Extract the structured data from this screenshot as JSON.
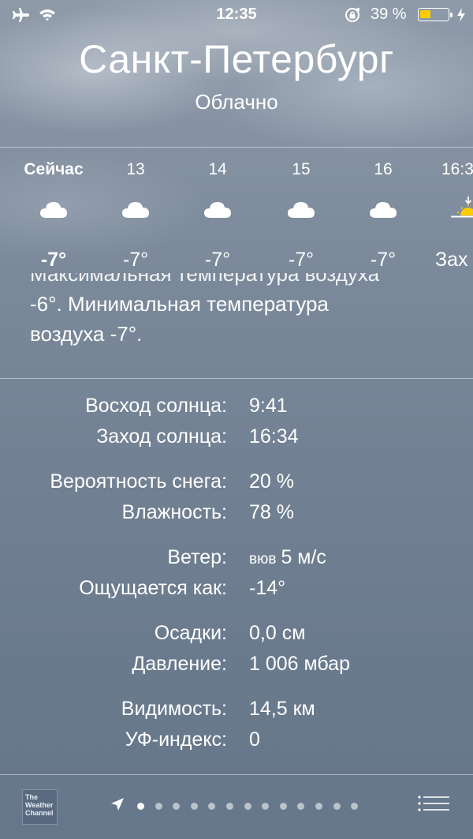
{
  "status_bar": {
    "time": "12:35",
    "battery_percent_text": "39 %",
    "battery_level": 0.39,
    "battery_color": "#ffcc00"
  },
  "header": {
    "city": "Санкт-Петербург",
    "condition": "Облачно"
  },
  "hourly": [
    {
      "label": "Сейчас",
      "icon": "cloud-icon",
      "temp": "-7°"
    },
    {
      "label": "13",
      "icon": "cloud-icon",
      "temp": "-7°"
    },
    {
      "label": "14",
      "icon": "cloud-icon",
      "temp": "-7°"
    },
    {
      "label": "15",
      "icon": "cloud-icon",
      "temp": "-7°"
    },
    {
      "label": "16",
      "icon": "cloud-icon",
      "temp": "-7°"
    },
    {
      "label": "16:3",
      "icon": "sunset-icon",
      "temp": "Зах"
    }
  ],
  "forecast_text": {
    "line1": "Максимальная температура воздуха",
    "line2": "-6°. Минимальная температура",
    "line3": "воздуха -7°."
  },
  "details": [
    {
      "label": "Восход солнца:",
      "value": "9:41"
    },
    {
      "label": "Заход солнца:",
      "value": "16:34"
    },
    {
      "label": "Вероятность снега:",
      "value": "20 %"
    },
    {
      "label": "Влажность:",
      "value": "78 %"
    },
    {
      "label": "Ветер:",
      "value_dir": "вюв",
      "value": "5 м/с"
    },
    {
      "label": "Ощущается как:",
      "value": "-14°"
    },
    {
      "label": "Осадки:",
      "value": "0,0 см"
    },
    {
      "label": "Давление:",
      "value": "1 006 мбар"
    },
    {
      "label": "Видимость:",
      "value": "14,5 км"
    },
    {
      "label": "УФ-индекс:",
      "value": "0"
    }
  ],
  "bottom_bar": {
    "logo_text": "The Weather Channel",
    "page_count": 13,
    "active_page": 0
  }
}
